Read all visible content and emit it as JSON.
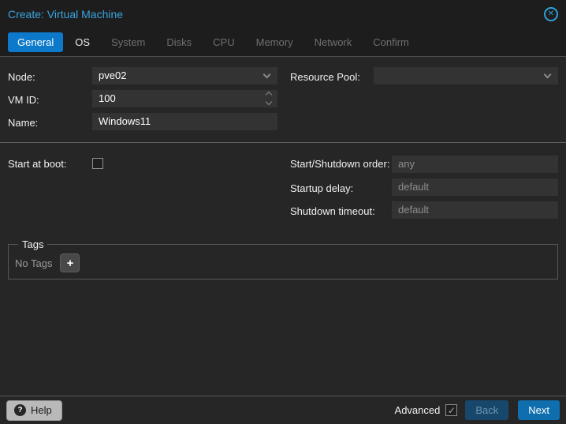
{
  "window": {
    "title": "Create: Virtual Machine"
  },
  "icons": {
    "close": "✕",
    "plus": "+",
    "help_question": "?",
    "advanced_check": "✓"
  },
  "tabs": [
    {
      "label": "General",
      "state": "active"
    },
    {
      "label": "OS",
      "state": "enabled"
    },
    {
      "label": "System",
      "state": "disabled"
    },
    {
      "label": "Disks",
      "state": "disabled"
    },
    {
      "label": "CPU",
      "state": "disabled"
    },
    {
      "label": "Memory",
      "state": "disabled"
    },
    {
      "label": "Network",
      "state": "disabled"
    },
    {
      "label": "Confirm",
      "state": "disabled"
    }
  ],
  "form": {
    "node": {
      "label": "Node:",
      "value": "pve02"
    },
    "vmid": {
      "label": "VM ID:",
      "value": "100"
    },
    "name": {
      "label": "Name:",
      "value": "Windows11"
    },
    "resource_pool": {
      "label": "Resource Pool:",
      "value": ""
    },
    "start_at_boot": {
      "label": "Start at boot:",
      "checked": false
    },
    "start_shutdown_order": {
      "label": "Start/Shutdown order:",
      "value": "",
      "placeholder": "any"
    },
    "startup_delay": {
      "label": "Startup delay:",
      "value": "",
      "placeholder": "default"
    },
    "shutdown_timeout": {
      "label": "Shutdown timeout:",
      "value": "",
      "placeholder": "default"
    },
    "tags": {
      "legend": "Tags",
      "empty_text": "No Tags"
    }
  },
  "footer": {
    "help_label": "Help",
    "advanced_label": "Advanced",
    "advanced_checked": true,
    "back_label": "Back",
    "next_label": "Next"
  },
  "colors": {
    "accent_blue": "#0c79ca",
    "title_blue": "#3aa5e0",
    "next_button_blue": "#0f6eae",
    "back_button_blue": "#17486c",
    "panel_bg": "#262626",
    "field_bg": "#333333"
  }
}
